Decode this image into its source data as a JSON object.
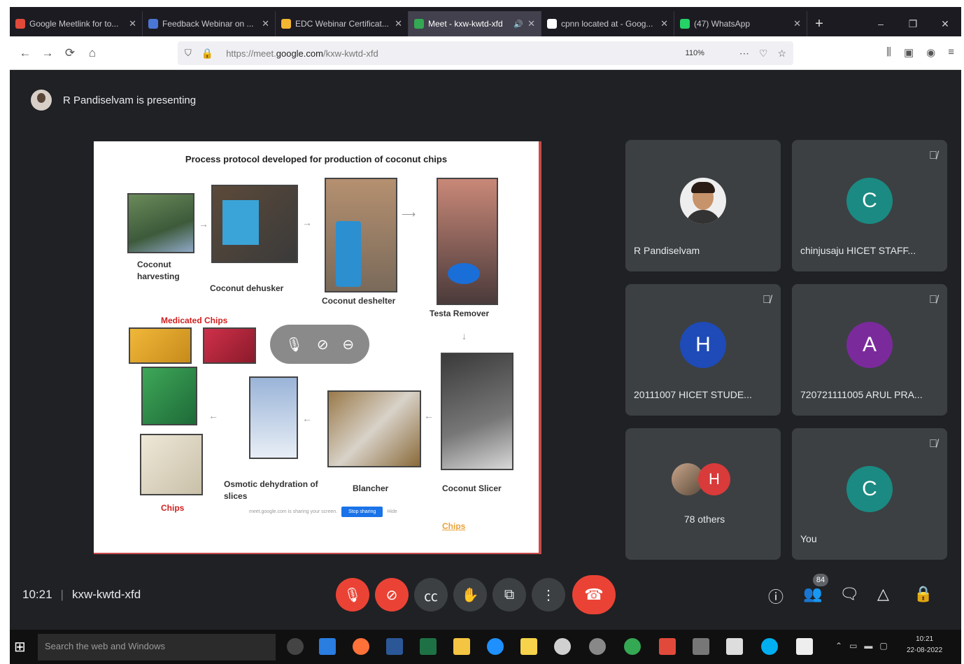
{
  "browser": {
    "tabs": [
      {
        "title": "Google Meetlink for to...",
        "close": "✕",
        "favicon_color": "#e14a3b",
        "active": false
      },
      {
        "title": "Feedback Webinar on ...",
        "close": "✕",
        "favicon_color": "#4a77d4",
        "active": false
      },
      {
        "title": "EDC Webinar Certificat...",
        "close": "✕",
        "favicon_color": "#f2b632",
        "active": false
      },
      {
        "title": "Meet - kxw-kwtd-xfd",
        "close": "✕",
        "favicon_color": "#34a853",
        "active": true,
        "audio": "🔊"
      },
      {
        "title": "cpnn located at - Goog...",
        "close": "✕",
        "favicon_color": "#ffffff",
        "active": false
      },
      {
        "title": "(47) WhatsApp",
        "close": "✕",
        "favicon_color": "#25d366",
        "active": false
      }
    ],
    "new_tab": "+",
    "window_controls": [
      "–",
      "❐",
      "✕"
    ],
    "url_prefix": "https://meet.",
    "url_domain": "google.com",
    "url_path": "/kxw-kwtd-xfd",
    "zoom": "110%"
  },
  "meet": {
    "presenting_text": "R Pandiselvam is presenting",
    "meeting_time": "10:21",
    "meeting_code": "kxw-kwtd-xfd",
    "participant_count": "84",
    "slide": {
      "title": "Process protocol developed for production of coconut chips",
      "captions": {
        "harvesting": "Coconut harvesting",
        "dehusker": "Coconut dehusker",
        "deshelter": "Coconut deshelter",
        "testa": "Testa Remover",
        "medicated": "Medicated Chips",
        "chips": "Chips",
        "osmotic": "Osmotic dehydration of slices",
        "blancher": "Blancher",
        "slicer": "Coconut Slicer",
        "chips_link": "Chips"
      },
      "share_text": "meet.google.com is sharing your screen.",
      "share_button": "Stop sharing",
      "share_hide": "Hide"
    },
    "tiles": [
      {
        "name": "R Pandiselvam",
        "initial": "",
        "color": "#5f6368"
      },
      {
        "name": "chinjusaju HICET STAFF...",
        "initial": "C",
        "color": "#1a8a82"
      },
      {
        "name": "20111007 HICET STUDE...",
        "initial": "H",
        "color": "#1f4bb8"
      },
      {
        "name": "720721111005 ARUL PRA...",
        "initial": "A",
        "color": "#7b2a9c"
      },
      {
        "name": "78 others",
        "initial": "H",
        "color": "#d93a3a"
      },
      {
        "name": "You",
        "initial": "C",
        "color": "#1a8a82"
      }
    ]
  },
  "taskbar": {
    "search_placeholder": "Search the web and Windows",
    "time": "10:21",
    "date": "22-08-2022"
  }
}
